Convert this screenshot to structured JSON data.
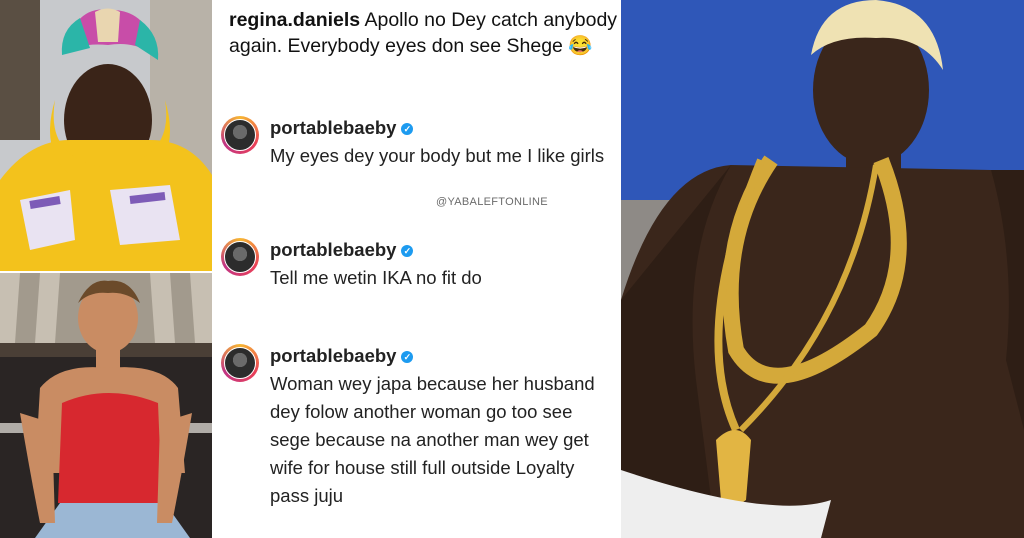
{
  "caption": {
    "username": "regina.daniels",
    "text": "Apollo no Dey catch anybody again. Everybody eyes don see Shege 😂"
  },
  "comments": [
    {
      "username": "portablebaeby",
      "verified_icon": "verified-badge-icon",
      "text": "My eyes dey your body but me I like girls"
    },
    {
      "username": "portablebaeby",
      "verified_icon": "verified-badge-icon",
      "text": "Tell me wetin IKA no fit do"
    },
    {
      "username": "portablebaeby",
      "verified_icon": "verified-badge-icon",
      "text": "Woman wey japa because her husband dey folow another woman go too see sege because na another man wey get wife for house still full outside Loyalty pass juju"
    }
  ],
  "watermark": "@YABALEFTONLINE",
  "colors": {
    "verified": "#1d9bf0",
    "text": "#222222",
    "photo_right_bg": "#2f57b8"
  }
}
